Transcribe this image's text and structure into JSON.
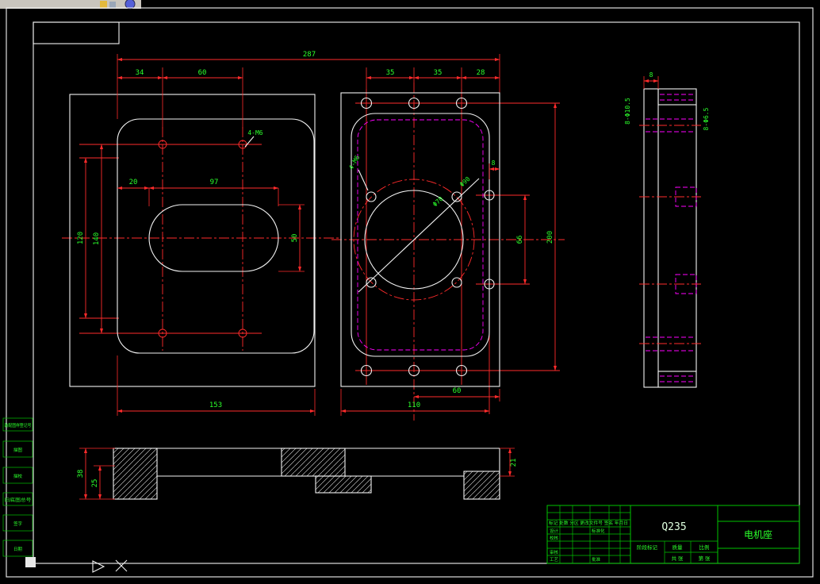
{
  "colors": {
    "background": "#000000",
    "geometry": "#f2f2f2",
    "centerline": "#ff2b2b",
    "hidden_line": "#ff00ff",
    "annotation": "#2bff2b",
    "frame_green": "#00c400",
    "toolbar": "#c9c5bd"
  },
  "margin": {
    "register_label": "装配图样登记号",
    "trace_label": "描图",
    "trace_check_label": "描校",
    "old_drawing_no_label": "旧底图总号",
    "signature_label": "签字",
    "date_label": "日期"
  },
  "views": {
    "front": {
      "dim_287": "287",
      "dim_34": "34",
      "dim_60": "60",
      "dim_20": "20",
      "dim_97": "97",
      "dim_120": "120",
      "dim_140": "140",
      "dim_50": "50",
      "dim_153": "153",
      "hole_callout": "4-M6"
    },
    "face": {
      "dim_35a": "35",
      "dim_35b": "35",
      "dim_28": "28",
      "dim_8": "8",
      "dim_200": "200",
      "dim_66": "66",
      "dim_110": "110",
      "dim_60": "60",
      "dia_bore": "Φ70",
      "dia_bolt_circle": "Φ90",
      "hole_callout": "4-M6"
    },
    "side": {
      "dim_8": "8",
      "hole_callout_counterbore": "8-Φ10.5",
      "hole_callout_through": "8-Φ6.5"
    },
    "section": {
      "dim_38": "38",
      "dim_25": "25",
      "dim_21": "21"
    }
  },
  "title_block": {
    "material": "Q235",
    "part_name": "电机座",
    "rev_header": "标记 处数 分区 更改文件号 签名 年月日",
    "design_label": "设计",
    "check_label": "校核",
    "review_label": "审核",
    "process_label": "工艺",
    "standard_label": "标准化",
    "approve_label": "批准",
    "stage_label": "阶段标记",
    "weight_label": "质量",
    "scale_label": "比例",
    "sheet_total_label": "共 张",
    "sheet_no_label": "第 张"
  }
}
